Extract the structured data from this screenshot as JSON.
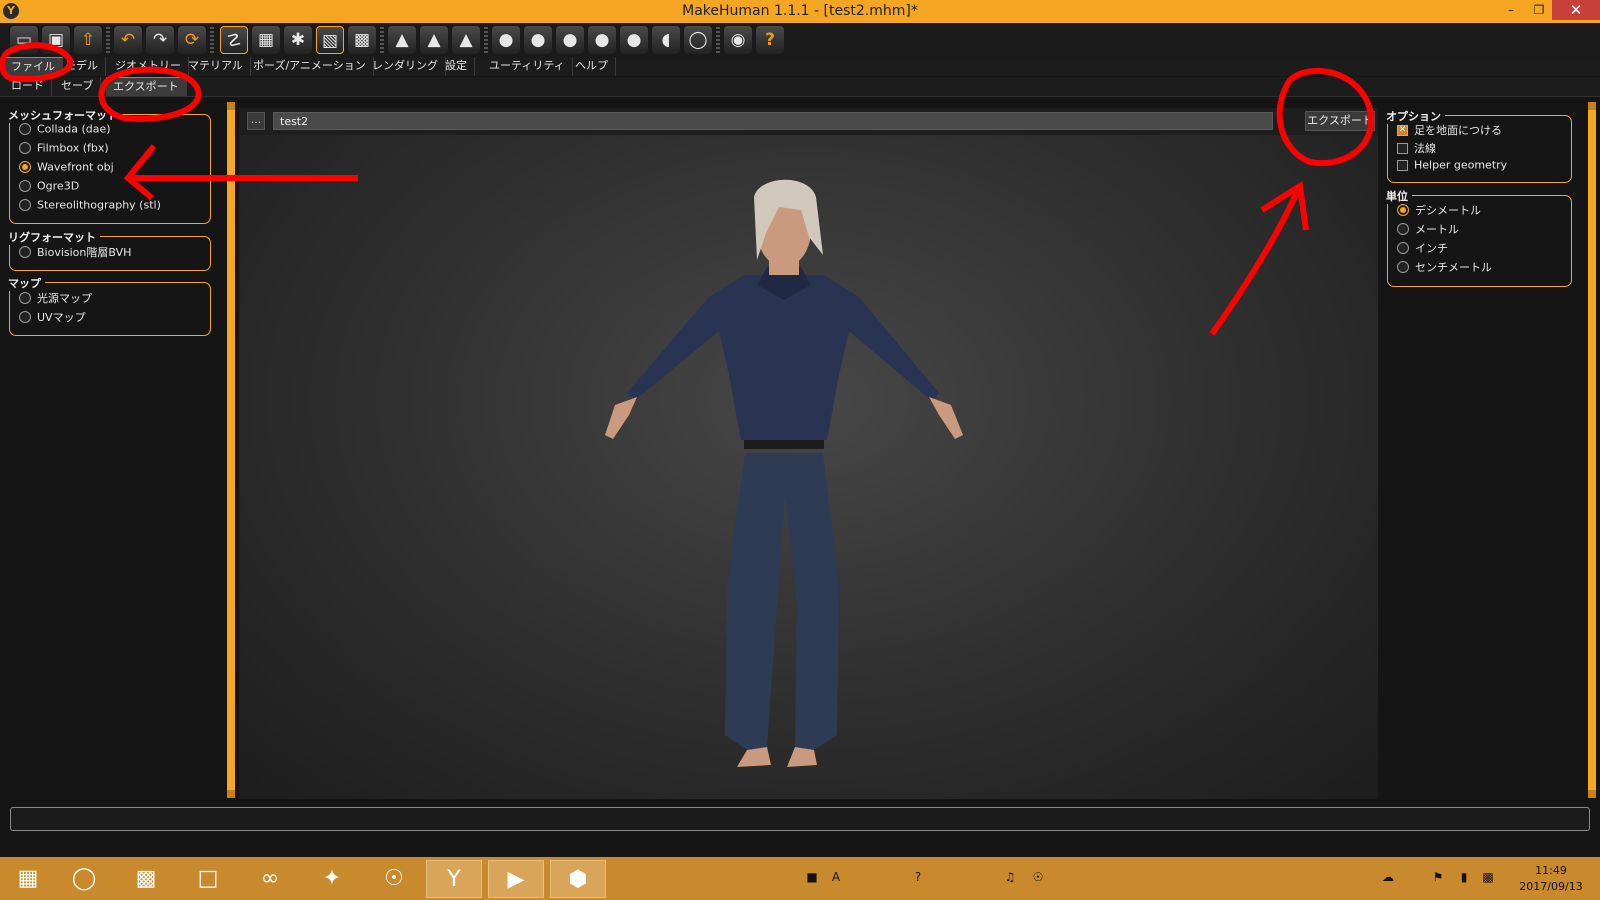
{
  "window": {
    "title": "MakeHuman 1.1.1 - [test2.mhm]*",
    "minimize": "–",
    "maximize": "❐",
    "close": "✕"
  },
  "toolbar": {
    "icons": [
      "file-load-icon",
      "save-icon",
      "export-icon",
      "undo-icon",
      "redo-icon",
      "reset-icon",
      "smooth-icon",
      "wireframe-icon",
      "pose-icon",
      "grid-icon",
      "checker-icon",
      "front-view-icon",
      "side-view-icon",
      "top-view-icon",
      "face-view-icon",
      "left-view-icon",
      "right-view-icon",
      "back-view-icon",
      "bottom-view-icon",
      "symmetry-icon",
      "reset-camera-icon",
      "screenshot-icon",
      "help-icon"
    ],
    "help_glyph": "?"
  },
  "main_tabs": [
    "ファイル",
    "モデル",
    "ジオメトリー",
    "マテリアル",
    "ポーズ/アニメーション",
    "レンダリング",
    "設定",
    "ユーティリティ",
    "ヘルプ"
  ],
  "sub_tabs": [
    "ロード",
    "セーブ",
    "エクスポート"
  ],
  "left_panel": {
    "mesh_format": {
      "title": "メッシュフォーマット",
      "options": [
        "Collada (dae)",
        "Filmbox (fbx)",
        "Wavefront obj",
        "Ogre3D",
        "Stereolithography (stl)"
      ],
      "selected": "Wavefront obj"
    },
    "rig_format": {
      "title": "リグフォーマット",
      "options": [
        "Biovision階層BVH"
      ]
    },
    "maps": {
      "title": "マップ",
      "options": [
        "光源マップ",
        "UVマップ"
      ]
    }
  },
  "export_bar": {
    "browse_label": "...",
    "filename": "test2",
    "export_label": "エクスポート"
  },
  "right_panel": {
    "options": {
      "title": "オプション",
      "items": [
        {
          "label": "足を地面につける",
          "checked": true
        },
        {
          "label": "法線",
          "checked": false
        },
        {
          "label": "Helper geometry",
          "checked": false
        }
      ]
    },
    "units": {
      "title": "単位",
      "options": [
        "デシメートル",
        "メートル",
        "インチ",
        "センチメートル"
      ],
      "selected": "デシメートル"
    }
  },
  "taskbar": {
    "clock_time": "11:49",
    "clock_date": "2017/09/13",
    "apps": [
      "windows-start-icon",
      "cd-drive-icon",
      "robot-app-icon",
      "dictionary-app-icon",
      "visual-studio-icon",
      "unity-icon",
      "blender-icon",
      "makehuman-icon",
      "media-player-icon",
      "shield-app-icon"
    ]
  },
  "colors": {
    "accent": "#f5a623",
    "annotation": "#ff0000",
    "background": "#151515"
  }
}
